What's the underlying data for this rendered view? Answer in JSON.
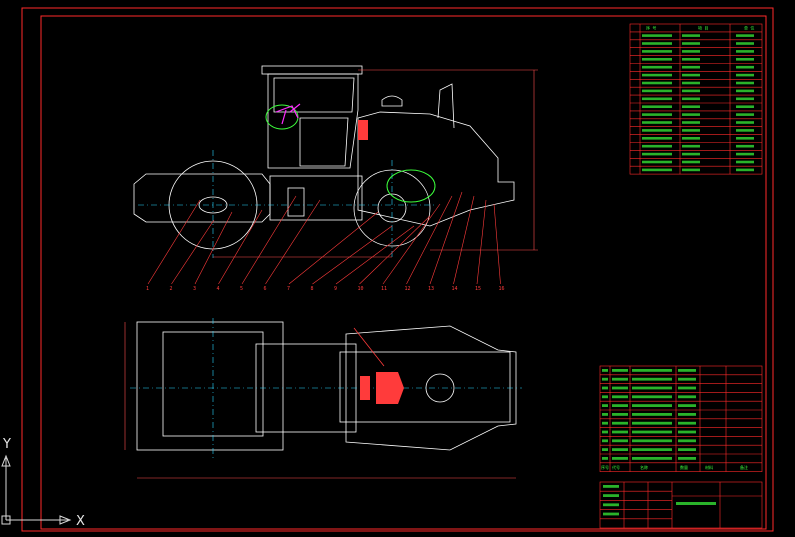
{
  "viewport": {
    "title": "CAD drawing viewport",
    "background": "#000000"
  },
  "colors": {
    "frame": "#ff2a2a",
    "outline": "#ffffff",
    "centerline": "#2ad6ff",
    "text": "#3cff3c",
    "magenta": "#ff2aff",
    "callout": "#ff3b3b",
    "dimension": "#ff4d4d",
    "ucs": "#d8d8d8"
  },
  "ucs": {
    "x_label": "X",
    "y_label": "Y",
    "icon": "ucs-axis-icon"
  },
  "callouts": [
    "1",
    "2",
    "3",
    "4",
    "5",
    "6",
    "7",
    "8",
    "9",
    "10",
    "11",
    "12",
    "13",
    "14",
    "15",
    "16"
  ],
  "spec_table": {
    "header": [
      "序 号",
      "项 目",
      "单 位"
    ],
    "rows": 19
  },
  "parts_list": {
    "rows": 12,
    "header": [
      "序号",
      "代号",
      "名称",
      "数量",
      "材料",
      "备注"
    ]
  },
  "title_block": {
    "rows": 5
  }
}
